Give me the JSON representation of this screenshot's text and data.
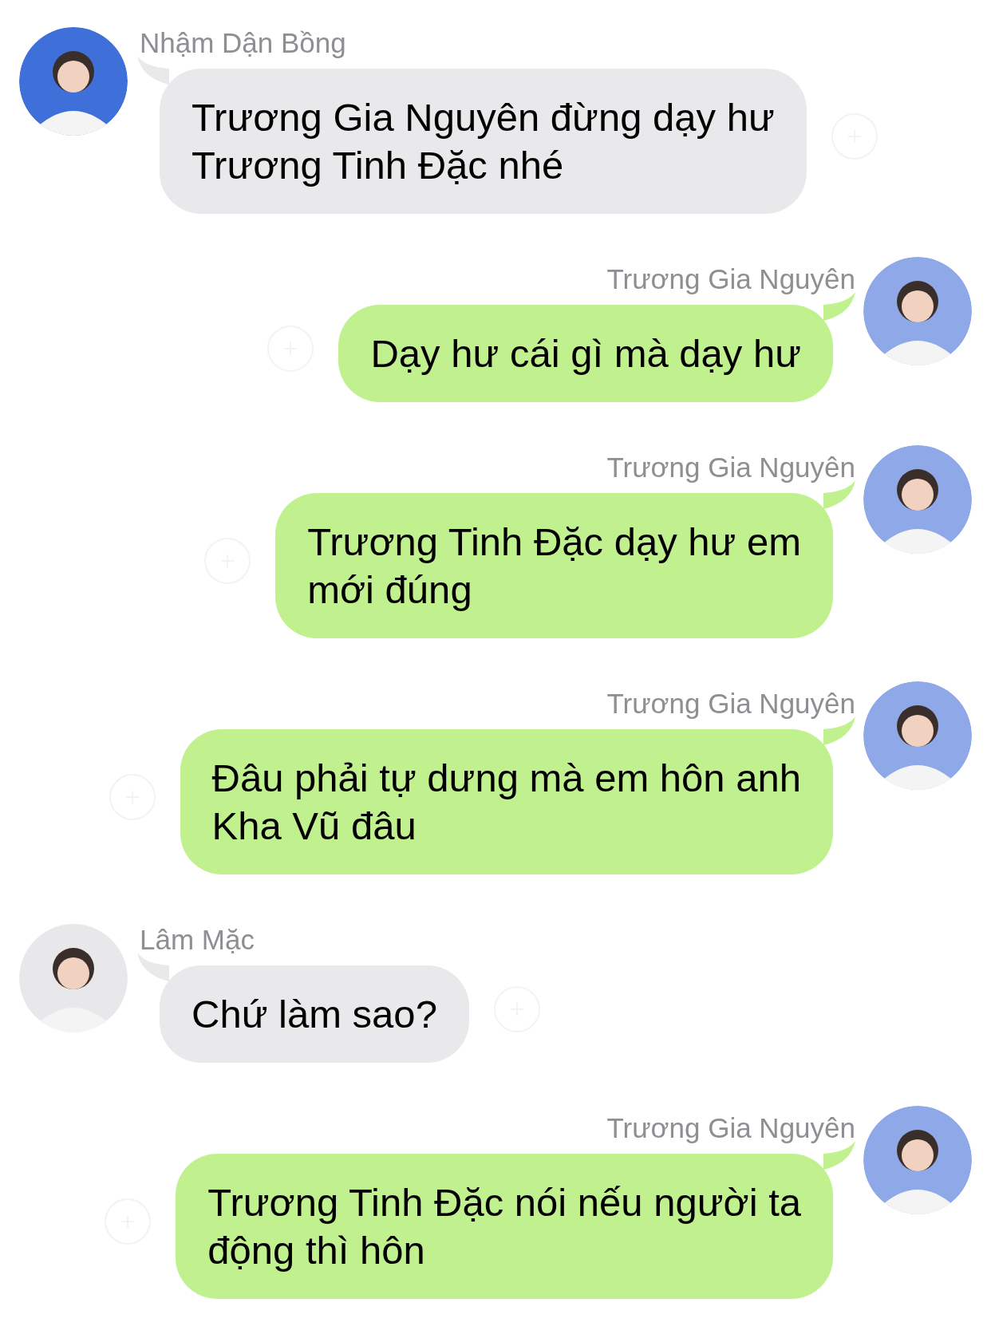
{
  "messages": [
    {
      "kind": "incoming",
      "sender": "Nhậm Dận Bồng",
      "lines": [
        "Trương Gia Nguyên đừng dạy hư",
        "Trương Tinh Đặc nhé"
      ]
    },
    {
      "kind": "outgoing",
      "sender": "Trương Gia Nguyên",
      "lines": [
        "Dạy hư cái gì mà dạy hư"
      ]
    },
    {
      "kind": "outgoing",
      "sender": "Trương Gia Nguyên",
      "lines": [
        "Trương Tinh Đặc dạy hư em",
        "mới đúng"
      ]
    },
    {
      "kind": "outgoing",
      "sender": "Trương Gia Nguyên",
      "lines": [
        "Đâu phải tự dưng mà em hôn anh",
        "Kha Vũ đâu"
      ]
    },
    {
      "kind": "incoming",
      "sender": "Lâm Mặc",
      "lines": [
        "Chứ làm sao?"
      ]
    },
    {
      "kind": "outgoing",
      "sender": "Trương Gia Nguyên",
      "lines": [
        "Trương Tinh Đặc nói nếu người ta",
        "động thì hôn"
      ]
    }
  ]
}
